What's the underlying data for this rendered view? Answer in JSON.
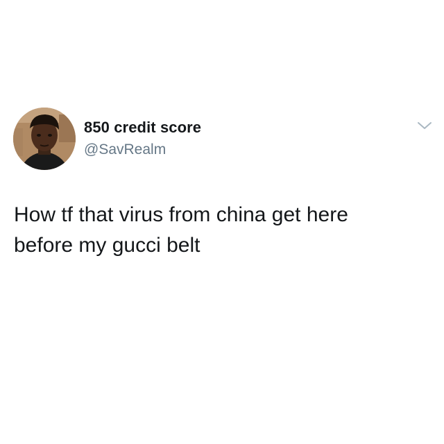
{
  "tweet": {
    "author": {
      "display_name": "850 credit score",
      "handle": "@SavRealm",
      "avatar": "profile-photo"
    },
    "text_lines": [
      "How tf that virus from china get here",
      "before my gucci belt"
    ],
    "menu_icon": "chevron-down-icon"
  },
  "colors": {
    "text_primary": "#14171a",
    "text_secondary": "#657786",
    "background": "#ffffff",
    "caret": "#aab8c2"
  }
}
